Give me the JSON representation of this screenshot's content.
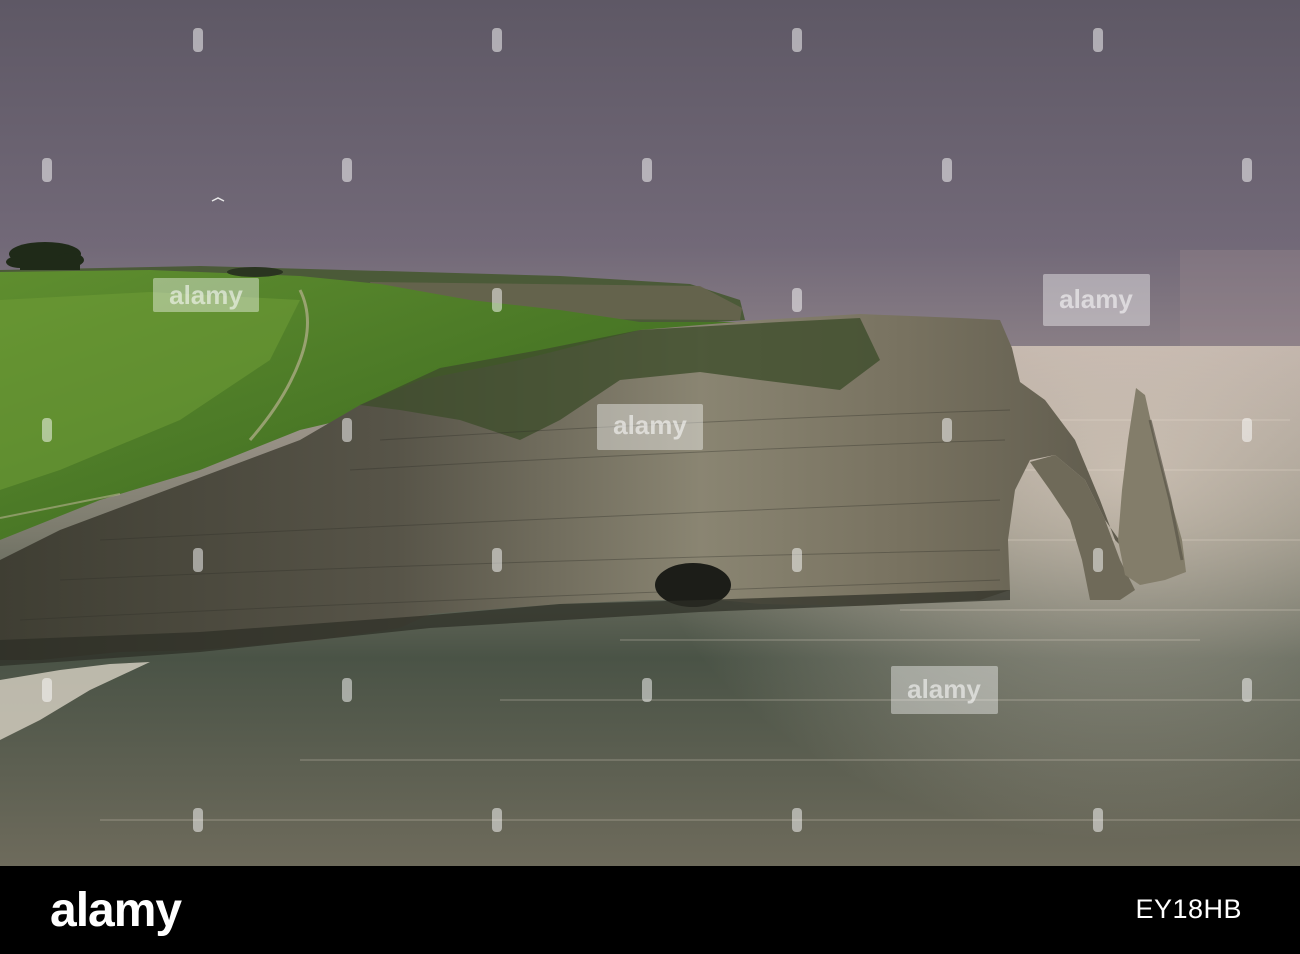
{
  "photo": {
    "subject": "chalk cliffs with sea arch and needle over the sea under an overcast sky",
    "colors": {
      "sky_top": "#5f5866",
      "sky_bottom": "#7a7080",
      "sea_near": "#394237",
      "sea_far": "#a79a92",
      "grass": "#4f7a2a",
      "cliff_light": "#7f7966",
      "cliff_dark": "#3a3b32"
    }
  },
  "watermark": {
    "brand": "alamy",
    "color": "#ffffff"
  },
  "footer": {
    "logo_text": "alamy",
    "image_id": "EY18HB",
    "background": "#000000"
  }
}
